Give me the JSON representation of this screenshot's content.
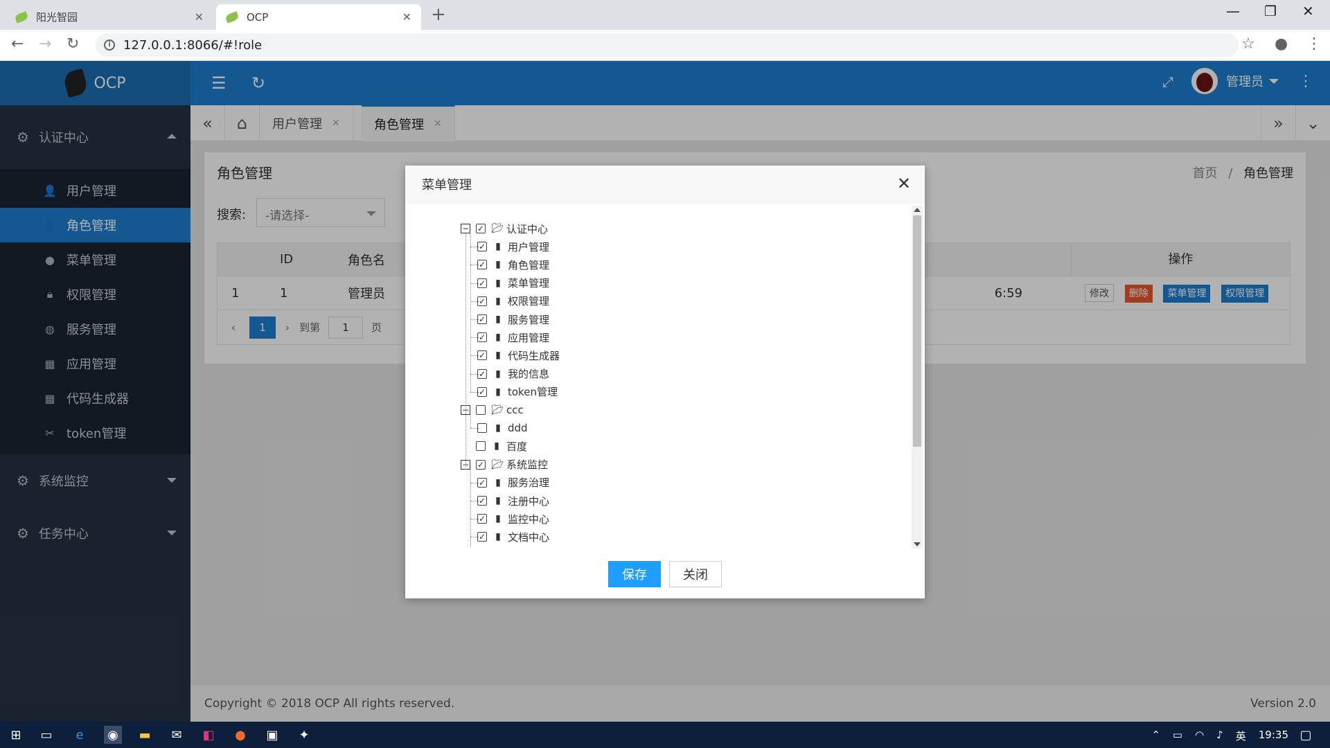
{
  "browser": {
    "tabs": [
      {
        "title": "阳光智园"
      },
      {
        "title": "OCP"
      }
    ],
    "url": "127.0.0.1:8066/#!role"
  },
  "header": {
    "app_name": "OCP",
    "user_name": "管理员"
  },
  "sidebar": {
    "groups": [
      {
        "label": "认证中心",
        "expanded": true
      },
      {
        "label": "系统监控",
        "expanded": false
      },
      {
        "label": "任务中心",
        "expanded": false
      }
    ],
    "items": [
      {
        "label": "用户管理",
        "icon": "user-icon"
      },
      {
        "label": "角色管理",
        "icon": "user-icon",
        "active": true
      },
      {
        "label": "菜单管理",
        "icon": "circle-icon"
      },
      {
        "label": "权限管理",
        "icon": "lock-icon"
      },
      {
        "label": "服务管理",
        "icon": "globe-icon"
      },
      {
        "label": "应用管理",
        "icon": "apps-icon"
      },
      {
        "label": "代码生成器",
        "icon": "apps-icon"
      },
      {
        "label": "token管理",
        "icon": "tools-icon"
      }
    ]
  },
  "page_tabs": [
    {
      "label": "用户管理"
    },
    {
      "label": "角色管理",
      "active": true
    }
  ],
  "content": {
    "title": "角色管理",
    "breadcrumb": {
      "home": "首页",
      "sep": "/",
      "current": "角色管理"
    },
    "search_label": "搜索:",
    "search_select": "-请选择-",
    "table": {
      "headers": {
        "id": "ID",
        "name": "角色名",
        "ops": "操作"
      },
      "row": {
        "index": "1",
        "id": "1",
        "name": "管理员",
        "time_fragment": "6:59"
      },
      "actions": {
        "edit": "修改",
        "delete": "删除",
        "menu": "菜单管理",
        "perm": "权限管理"
      }
    },
    "pager": {
      "current": "1",
      "goto_label": "到第",
      "goto_value": "1",
      "page_label": "页"
    }
  },
  "modal": {
    "title": "菜单管理",
    "tree": [
      {
        "label": "认证中心",
        "checked": true,
        "folder": true,
        "expanded": true,
        "level": 0
      },
      {
        "label": "用户管理",
        "checked": true,
        "level": 1
      },
      {
        "label": "角色管理",
        "checked": true,
        "level": 1
      },
      {
        "label": "菜单管理",
        "checked": true,
        "level": 1
      },
      {
        "label": "权限管理",
        "checked": true,
        "level": 1
      },
      {
        "label": "服务管理",
        "checked": true,
        "level": 1
      },
      {
        "label": "应用管理",
        "checked": true,
        "level": 1
      },
      {
        "label": "代码生成器",
        "checked": true,
        "level": 1
      },
      {
        "label": "我的信息",
        "checked": true,
        "level": 1
      },
      {
        "label": "token管理",
        "checked": true,
        "level": 1
      },
      {
        "label": "ccc",
        "checked": false,
        "folder": true,
        "expanded": true,
        "level": 0
      },
      {
        "label": "ddd",
        "checked": false,
        "level": 1
      },
      {
        "label": "百度",
        "checked": false,
        "level": 0
      },
      {
        "label": "系统监控",
        "checked": true,
        "folder": true,
        "expanded": true,
        "level": 0
      },
      {
        "label": "服务治理",
        "checked": true,
        "level": 1
      },
      {
        "label": "注册中心",
        "checked": true,
        "level": 1
      },
      {
        "label": "监控中心",
        "checked": true,
        "level": 1
      },
      {
        "label": "文档中心",
        "checked": true,
        "level": 1
      }
    ],
    "save_label": "保存",
    "close_label": "关闭"
  },
  "footer": {
    "copyright": "Copyright © 2018 OCP All rights reserved.",
    "version": "Version 2.0"
  },
  "taskbar": {
    "ime": "英",
    "time": "19:35"
  },
  "colors": {
    "primary": "#1d7fd0",
    "sidebar_bg": "#253346",
    "danger": "#e8572a",
    "save_button": "#1e9fff"
  }
}
